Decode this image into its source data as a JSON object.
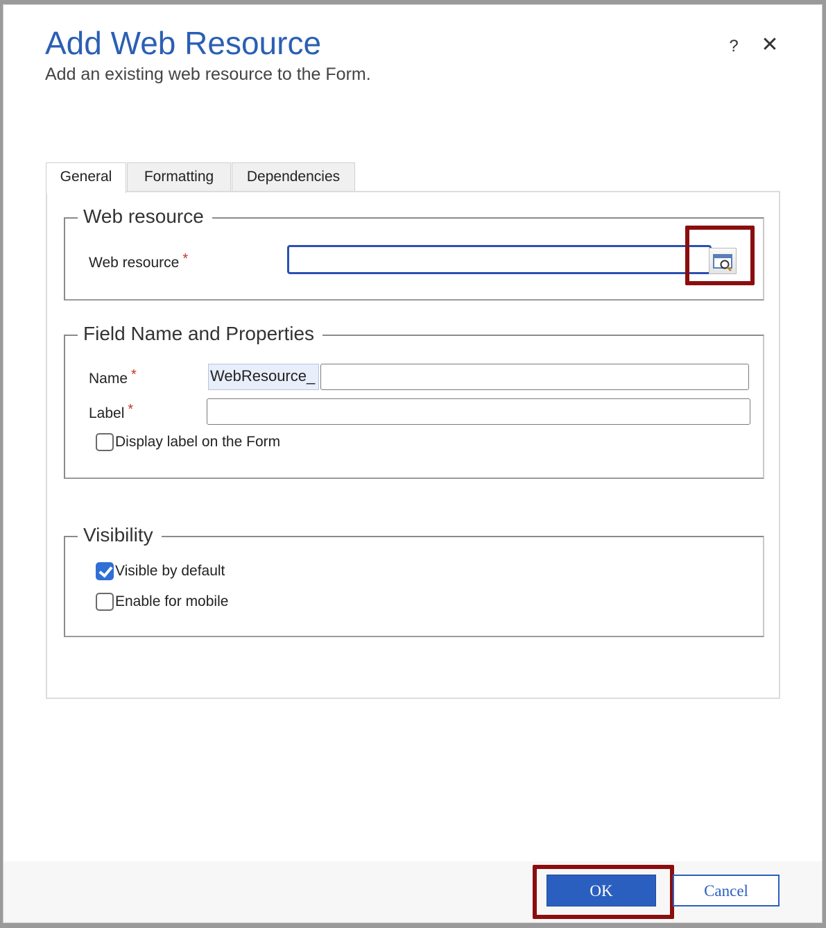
{
  "dialog": {
    "title": "Add Web Resource",
    "subtitle": "Add an existing web resource to the Form.",
    "help_label": "?",
    "close_label": "✕"
  },
  "tabs": [
    {
      "label": "General",
      "active": true
    },
    {
      "label": "Formatting",
      "active": false
    },
    {
      "label": "Dependencies",
      "active": false
    }
  ],
  "web_resource_section": {
    "legend": "Web resource",
    "field_label": "Web resource",
    "required_mark": "*",
    "value": ""
  },
  "field_properties_section": {
    "legend": "Field Name and Properties",
    "name_label": "Name",
    "name_prefix": "WebResource_",
    "name_value": "",
    "label_label": "Label",
    "label_value": "",
    "required_mark": "*",
    "display_label_checkbox": {
      "label": "Display label on the Form",
      "checked": false
    }
  },
  "visibility_section": {
    "legend": "Visibility",
    "visible_by_default": {
      "label": "Visible by default",
      "checked": true
    },
    "enable_for_mobile": {
      "label": "Enable for mobile",
      "checked": false
    }
  },
  "footer": {
    "ok_label": "OK",
    "cancel_label": "Cancel"
  },
  "colors": {
    "accent": "#2b5fb4",
    "highlight": "#8b0e0e",
    "required": "#c0392b"
  },
  "icons": {
    "lookup": "lookup-search-icon",
    "close": "close-icon",
    "help": "help-icon"
  }
}
